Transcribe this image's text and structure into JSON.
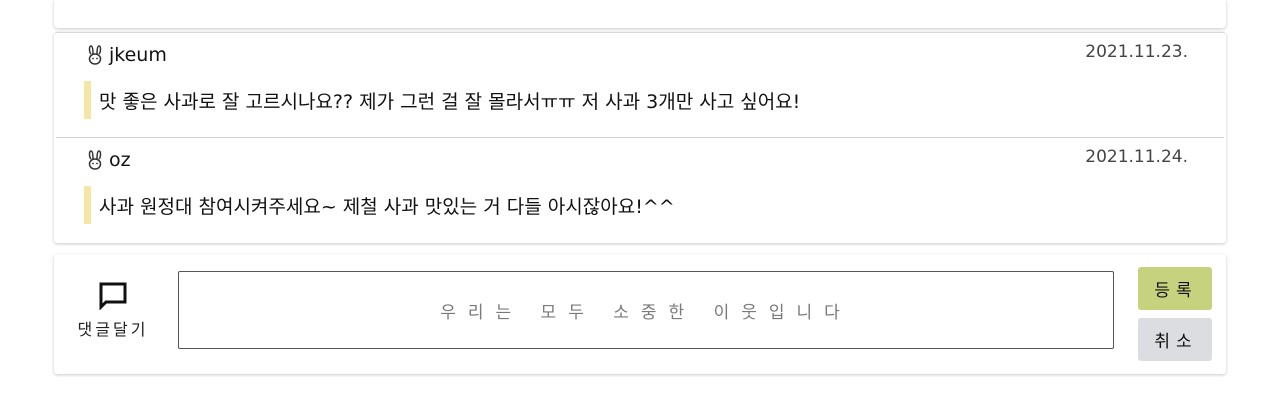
{
  "comments": [
    {
      "author": "jkeum",
      "date": "2021.11.23.",
      "text": "맛 좋은 사과로 잘 고르시나요?? 제가 그런 걸 잘 몰라서ㅠㅠ 저 사과 3개만 사고 싶어요!"
    },
    {
      "author": "oz",
      "date": "2021.11.24.",
      "text": "사과 원정대 참여시켜주세요~ 제철 사과 맛있는 거 다들 아시잖아요!^^"
    }
  ],
  "form": {
    "label": "댓글달기",
    "label_icon": "speech-bubble-icon",
    "placeholder": "우리는 모두 소중한 이웃입니다",
    "submit_label": "등록",
    "cancel_label": "취소"
  },
  "colors": {
    "quote_bar": "#f5e6a6",
    "submit_button": "#c7d27e",
    "cancel_button": "#dcdde0"
  }
}
